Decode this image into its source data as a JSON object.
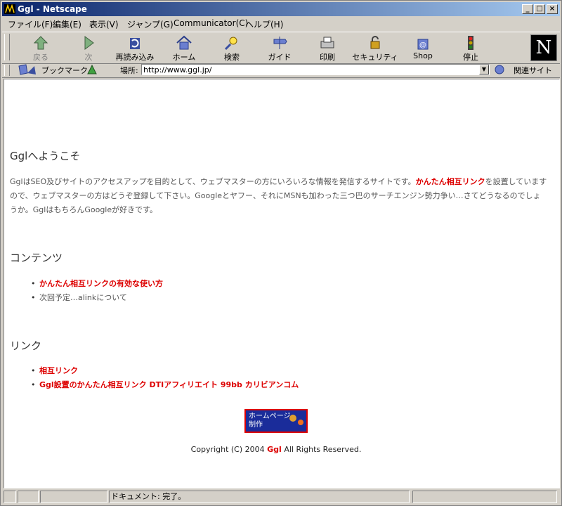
{
  "window": {
    "title": "Ggl - Netscape"
  },
  "menu": [
    "ファイル(F)",
    "編集(E)",
    "表示(V)",
    "ジャンプ(G)",
    "Communicator(C)",
    "ヘルプ(H)"
  ],
  "toolbar": {
    "back": "戻る",
    "forward": "次",
    "reload": "再読み込み",
    "home": "ホーム",
    "search": "検索",
    "guide": "ガイド",
    "print": "印刷",
    "security": "セキュリティ",
    "shop": "Shop",
    "stop": "停止",
    "logo": "N"
  },
  "location": {
    "bookmarks": "ブックマーク",
    "label": "場所:",
    "url": "http://www.ggl.jp/",
    "related": "関連サイト"
  },
  "page": {
    "welcome_heading": "Gglへようこそ",
    "intro_before": "GglはSEO及びサイトのアクセスアップを目的として、ウェブマスターの方にいろいろな情報を発信するサイトです。",
    "intro_link": "かんたん相互リンク",
    "intro_after": "を設置していますので、ウェブマスターの方はどうぞ登録して下さい。Googleとヤフー、それにMSNも加わった三つ巴のサーチエンジン勢力争い…さてどうなるのでしょうか。GglはもちろんGoogleが好きです。",
    "contents_heading": "コンテンツ",
    "contents": [
      {
        "text": "かんたん相互リンクの有効な使い方",
        "link": true
      },
      {
        "text": "次回予定…alinkについて",
        "link": false
      }
    ],
    "links_heading": "リンク",
    "links": [
      {
        "text": "相互リンク"
      },
      {
        "text": "Ggl設置のかんたん相互リンク DTIアフィリエイト 99bb カリビアンコム"
      }
    ],
    "banner_line1": "ホームページ",
    "banner_line2": "制作",
    "copyright_before": "Copyright (C) 2004",
    "copyright_brand": "Ggl",
    "copyright_after": "All Rights Reserved."
  },
  "status": {
    "text": "ドキュメント: 完了。"
  },
  "colors": {
    "link": "#dd0000",
    "titlebar": "#0a246a",
    "chrome": "#d4d0c8"
  }
}
